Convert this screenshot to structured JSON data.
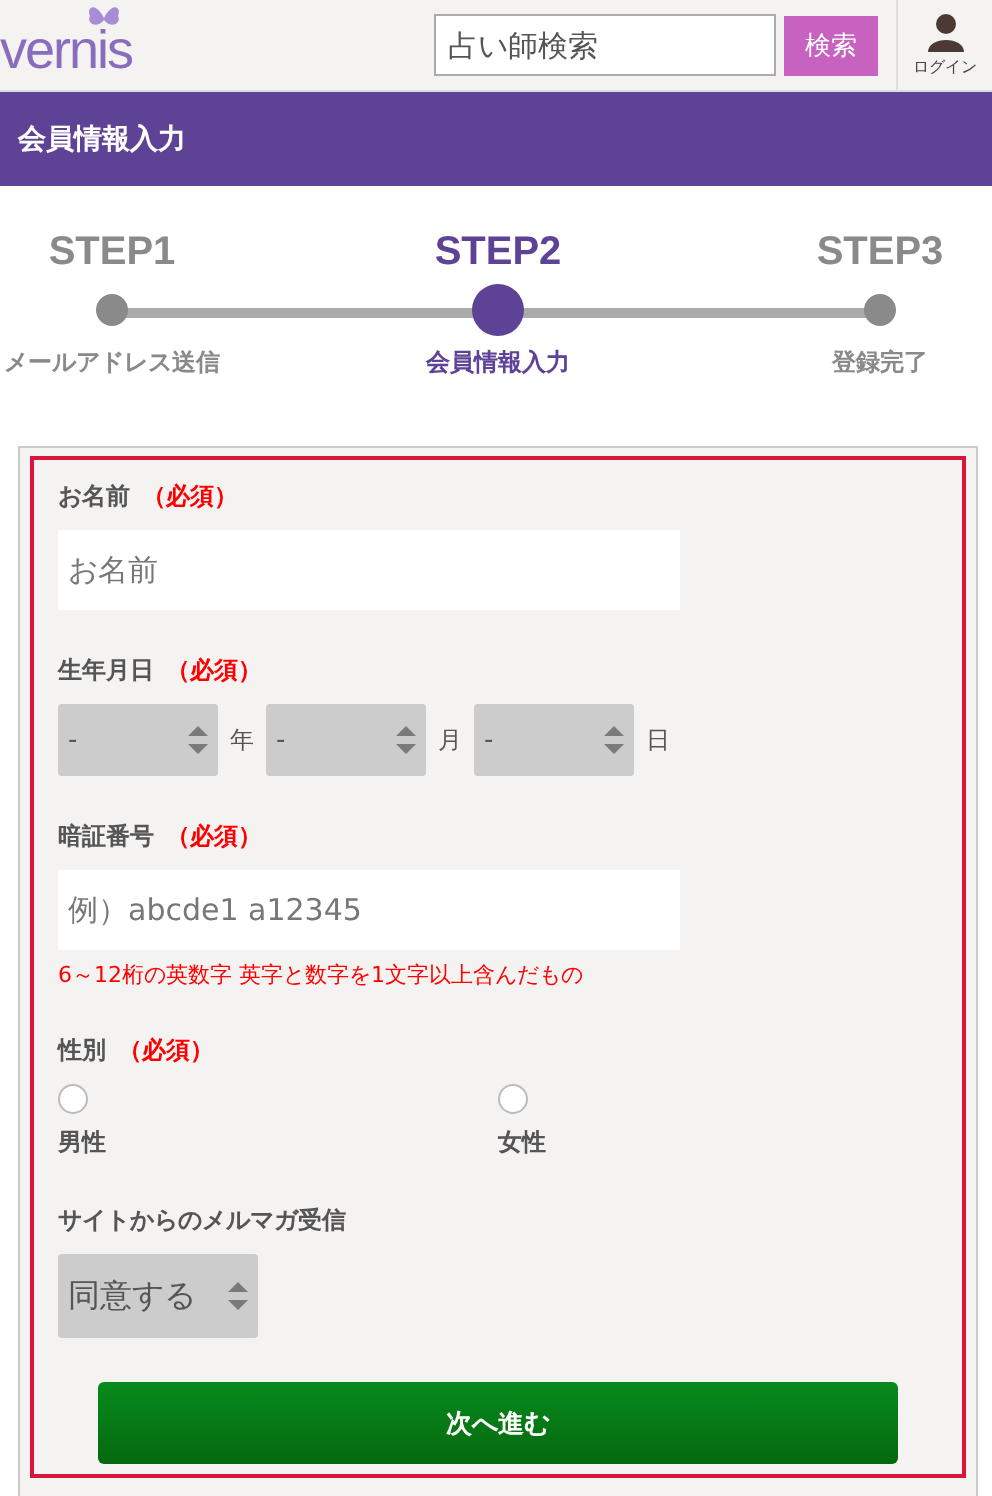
{
  "header": {
    "logo": "vernis",
    "search": {
      "placeholder": "占い師検索"
    },
    "search_button": "検索",
    "login": "ログイン"
  },
  "title_bar": "会員情報入力",
  "steps": [
    {
      "label": "STEP1",
      "caption": "メールアドレス送信",
      "selected": false
    },
    {
      "label": "STEP2",
      "caption": "会員情報入力",
      "selected": true
    },
    {
      "label": "STEP3",
      "caption": "登録完了",
      "selected": false
    }
  ],
  "form": {
    "fields": [
      {
        "kind": "text",
        "label": "お名前",
        "required": "（必須）",
        "placeholder": "お名前"
      },
      {
        "kind": "date",
        "label": "生年月日",
        "required": "（必須）",
        "selects": [
          {
            "value": "-",
            "unit": "年"
          },
          {
            "value": "-",
            "unit": "月"
          },
          {
            "value": "-",
            "unit": "日"
          }
        ]
      },
      {
        "kind": "text",
        "label": "暗証番号",
        "required": "（必須）",
        "placeholder": "例）abcde1 a12345",
        "note": "6～12桁の英数字 英字と数字を1文字以上含んだもの"
      },
      {
        "kind": "radio",
        "label": "性別",
        "required": "（必須）",
        "options": [
          {
            "label": "男性",
            "selected": false
          },
          {
            "label": "女性",
            "selected": false
          }
        ]
      },
      {
        "kind": "select",
        "label": "サイトからのメルマガ受信",
        "value": "同意する"
      }
    ],
    "submit": "次へ進む"
  }
}
